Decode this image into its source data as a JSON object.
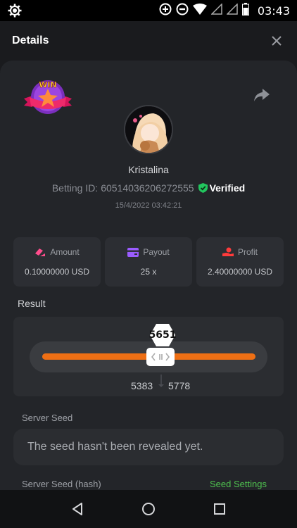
{
  "status_bar": {
    "time": "03:43"
  },
  "header": {
    "title": "Details"
  },
  "player": {
    "name": "Kristalina",
    "betting_id_label": "Betting ID:",
    "betting_id": "60514036206272555",
    "verified_label": "Verified",
    "timestamp": "15/4/2022 03:42:21"
  },
  "badge": {
    "text": "WIN"
  },
  "stats": {
    "amount": {
      "label": "Amount",
      "value": "0.10000000 USD"
    },
    "payout": {
      "label": "Payout",
      "value": "25 x"
    },
    "profit": {
      "label": "Profit",
      "value": "2.40000000 USD"
    }
  },
  "result": {
    "label": "Result",
    "value": "5651",
    "range_low": "5383",
    "range_high": "5778"
  },
  "server_seed": {
    "label": "Server Seed",
    "message": "The seed hasn't been revealed yet.",
    "hash_label": "Server Seed (hash)",
    "settings_link": "Seed Settings"
  },
  "colors": {
    "accent_orange": "#ee6f14",
    "verified_green": "#22c55e",
    "link_green": "#4fc24f",
    "amount_icon": "#ff4d8d",
    "payout_icon": "#9b5cff",
    "profit_icon": "#ff3b3b"
  }
}
